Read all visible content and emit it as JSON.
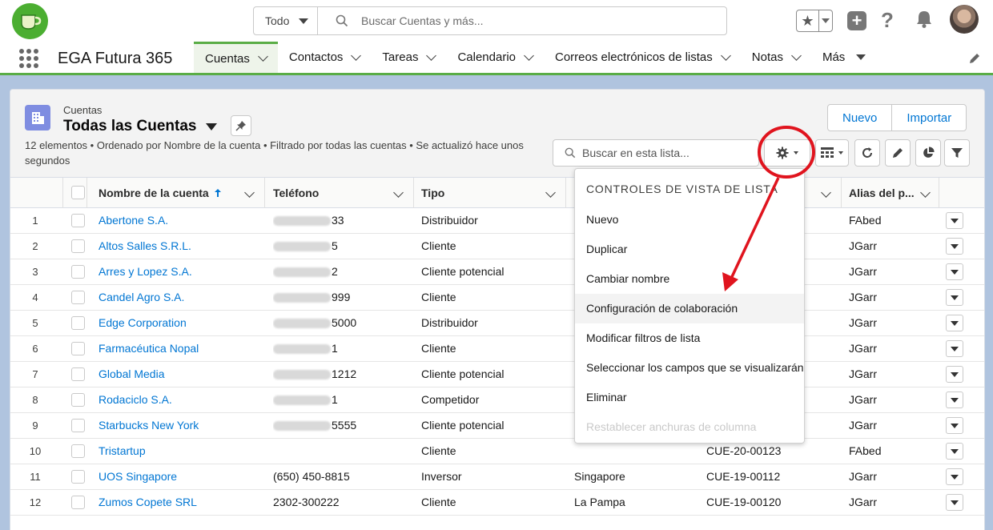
{
  "header": {
    "scope_label": "Todo",
    "search_placeholder": "Buscar Cuentas y más..."
  },
  "nav": {
    "app_name": "EGA Futura 365",
    "tabs": [
      {
        "label": "Cuentas"
      },
      {
        "label": "Contactos"
      },
      {
        "label": "Tareas"
      },
      {
        "label": "Calendario"
      },
      {
        "label": "Correos electrónicos de listas"
      },
      {
        "label": "Notas"
      },
      {
        "label": "Más"
      }
    ]
  },
  "list_header": {
    "object_label": "Cuentas",
    "view_name": "Todas las Cuentas",
    "meta_text": "12 elementos • Ordenado por Nombre de la cuenta • Filtrado por todas las cuentas • Se actualizó hace unos segundos",
    "new_label": "Nuevo",
    "import_label": "Importar",
    "list_search_placeholder": "Buscar en esta lista..."
  },
  "table": {
    "columns": {
      "name": "Nombre de la cuenta",
      "phone": "Teléfono",
      "type": "Tipo",
      "alias": "Alias del p..."
    },
    "rows": [
      {
        "n": "1",
        "name": "Abertone S.A.",
        "phone": "33",
        "type": "Distribuidor",
        "city": "",
        "code": "",
        "alias": "FAbed"
      },
      {
        "n": "2",
        "name": "Altos Salles S.R.L.",
        "phone": "5",
        "type": "Cliente",
        "city": "",
        "code": "",
        "alias": "JGarr"
      },
      {
        "n": "3",
        "name": "Arres y Lopez S.A.",
        "phone": "2",
        "type": "Cliente potencial",
        "city": "",
        "code": "",
        "alias": "JGarr"
      },
      {
        "n": "4",
        "name": "Candel Agro S.A.",
        "phone": "999",
        "type": "Cliente",
        "city": "",
        "code": "",
        "alias": "JGarr"
      },
      {
        "n": "5",
        "name": "Edge Corporation",
        "phone": "5000",
        "type": "Distribuidor",
        "city": "",
        "code": "",
        "alias": "JGarr"
      },
      {
        "n": "6",
        "name": "Farmacéutica Nopal",
        "phone": "1",
        "type": "Cliente",
        "city": "",
        "code": "",
        "alias": "JGarr"
      },
      {
        "n": "7",
        "name": "Global Media",
        "phone": "1212",
        "type": "Cliente potencial",
        "city": "",
        "code": "",
        "alias": "JGarr"
      },
      {
        "n": "8",
        "name": "Rodaciclo S.A.",
        "phone": "1",
        "type": "Competidor",
        "city": "",
        "code": "",
        "alias": "JGarr"
      },
      {
        "n": "9",
        "name": "Starbucks New York",
        "phone": "5555",
        "type": "Cliente potencial",
        "city": "",
        "code": "",
        "alias": "JGarr"
      },
      {
        "n": "10",
        "name": "Tristartup",
        "phone": "",
        "type": "Cliente",
        "city": "",
        "code": "CUE-20-00123",
        "alias": "FAbed"
      },
      {
        "n": "11",
        "name": "UOS Singapore",
        "phone": "(650) 450-8815",
        "type": "Inversor",
        "city": "Singapore",
        "code": "CUE-19-00112",
        "alias": "JGarr"
      },
      {
        "n": "12",
        "name": "Zumos Copete SRL",
        "phone": "2302-300222",
        "type": "Cliente",
        "city": "La Pampa",
        "code": "CUE-19-00120",
        "alias": "JGarr"
      }
    ]
  },
  "menu": {
    "title": "CONTROLES DE VISTA DE LISTA",
    "items": [
      {
        "label": "Nuevo"
      },
      {
        "label": "Duplicar"
      },
      {
        "label": "Cambiar nombre"
      },
      {
        "label": "Configuración de colaboración"
      },
      {
        "label": "Modificar filtros de lista"
      },
      {
        "label": "Seleccionar los campos que se visualizarán"
      },
      {
        "label": "Eliminar"
      },
      {
        "label": "Restablecer anchuras de columna"
      }
    ]
  },
  "colors": {
    "brand_green": "#5aad46",
    "link_blue": "#0176d3",
    "annotation_red": "#e0141e"
  }
}
